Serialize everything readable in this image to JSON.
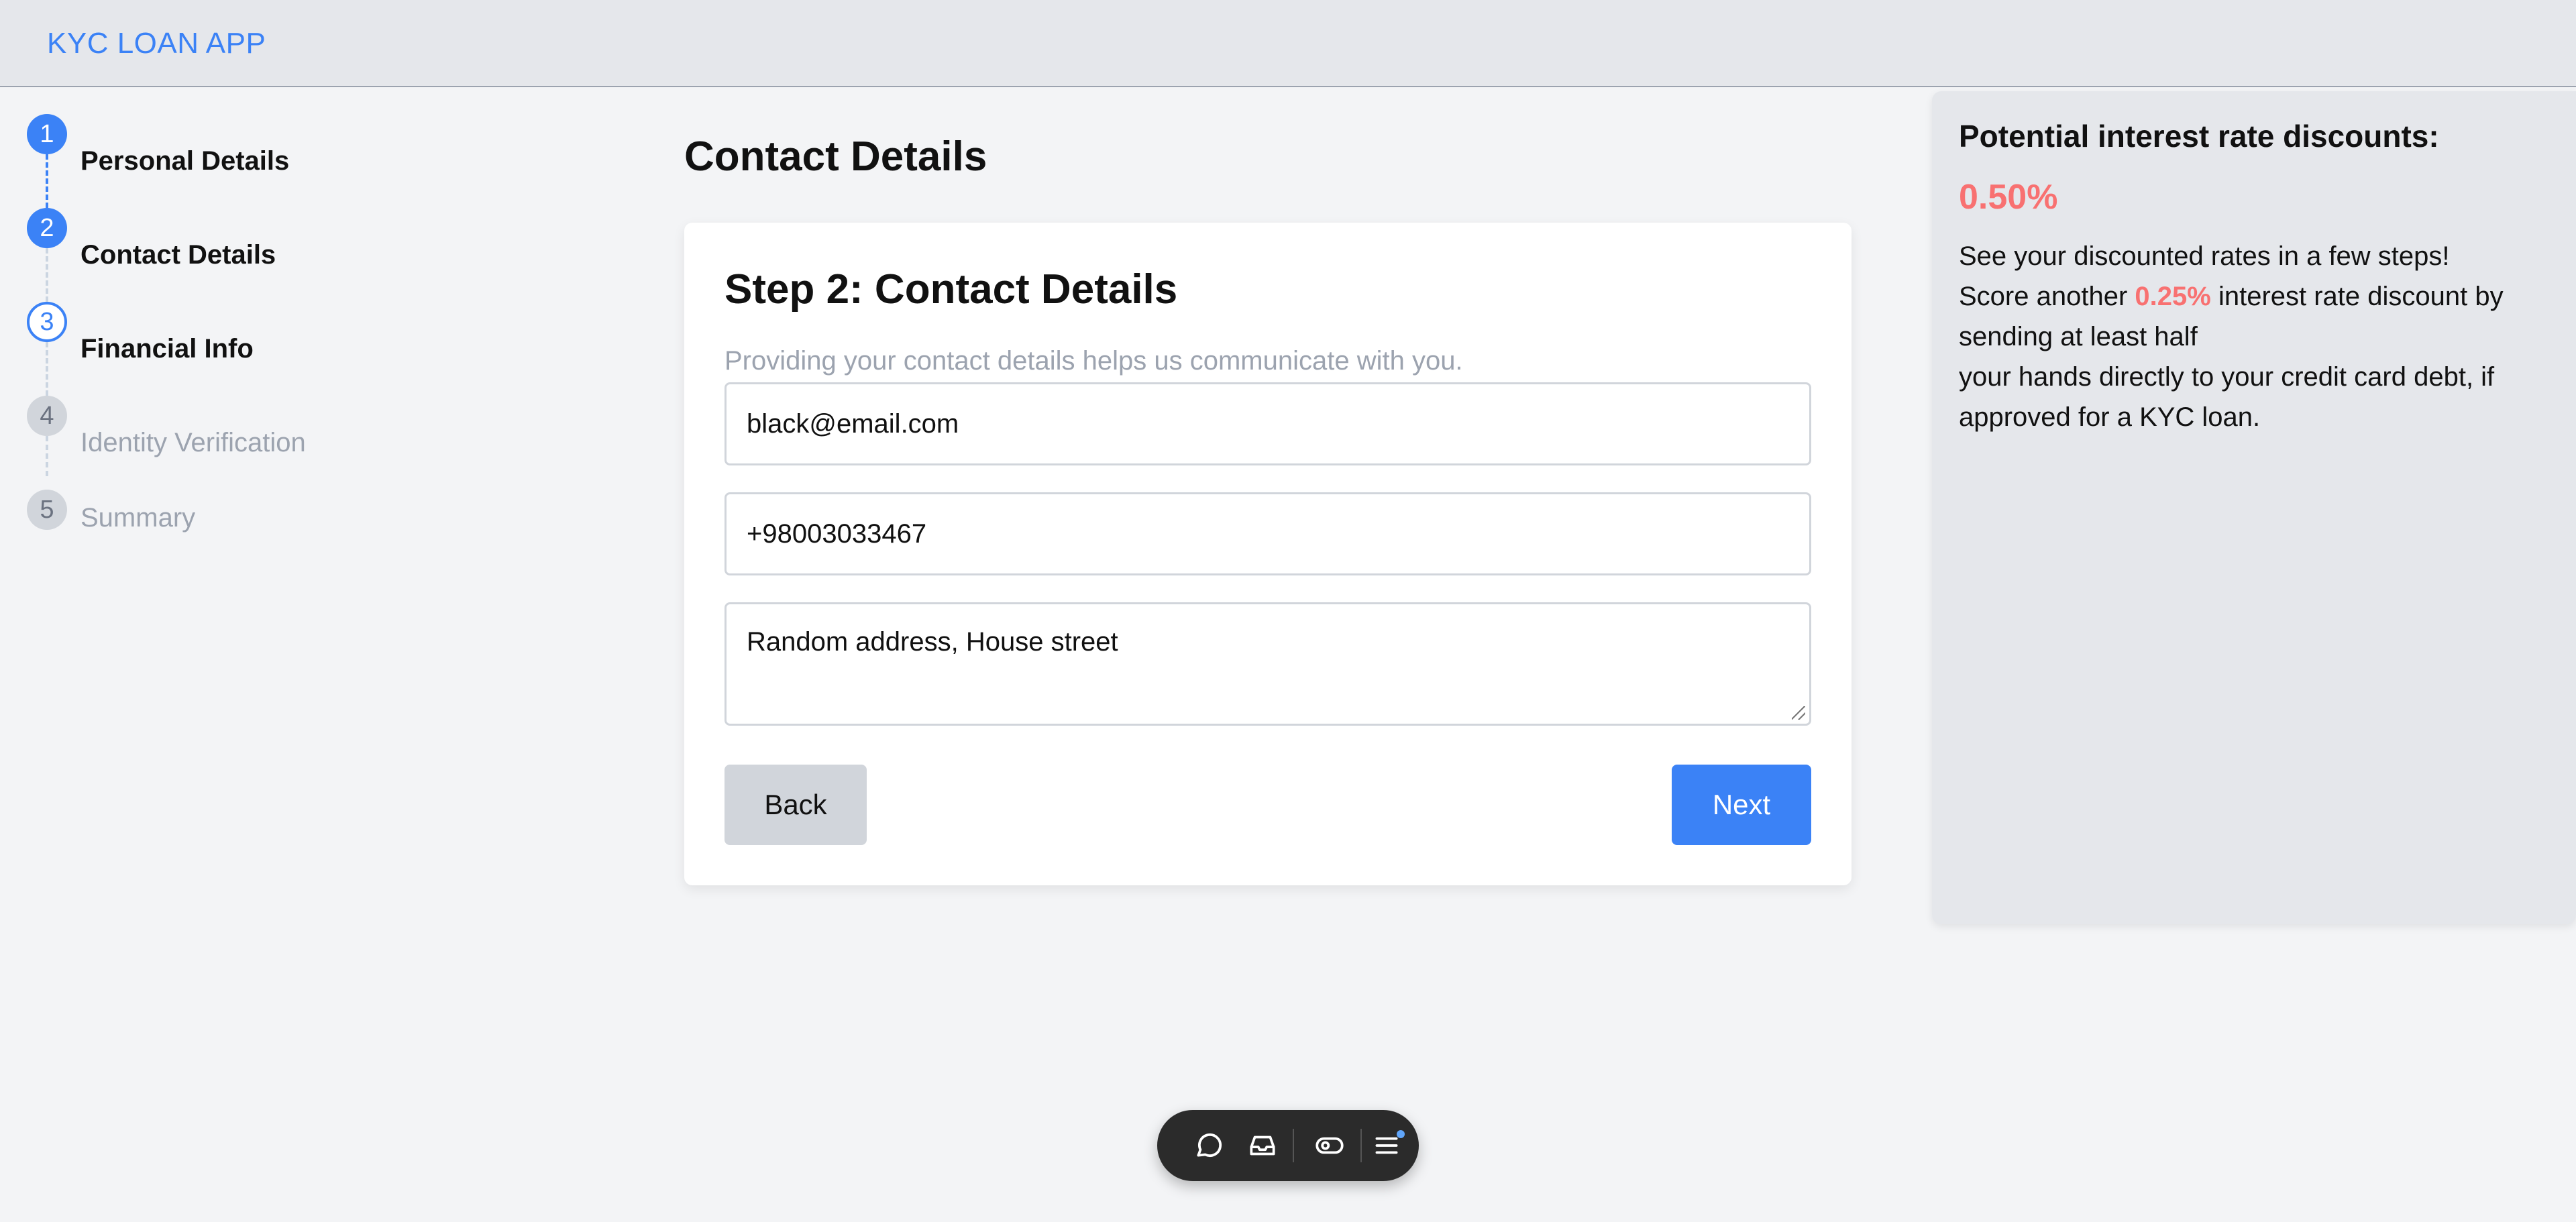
{
  "app": {
    "brand": "KYC LOAN APP"
  },
  "stepper": {
    "steps": [
      {
        "num": "1",
        "label": "Personal Details",
        "state": "complete"
      },
      {
        "num": "2",
        "label": "Contact Details",
        "state": "current"
      },
      {
        "num": "3",
        "label": "Financial Info",
        "state": "next"
      },
      {
        "num": "4",
        "label": "Identity Verification",
        "state": "pending"
      },
      {
        "num": "5",
        "label": "Summary",
        "state": "pending"
      }
    ]
  },
  "main": {
    "page_title": "Contact Details",
    "card": {
      "title": "Step 2: Contact Details",
      "description": "Providing your contact details helps us communicate with you.",
      "email_value": "black@email.com",
      "phone_value": "+98003033467",
      "address_value": "Random address, House street",
      "back_label": "Back",
      "next_label": "Next"
    }
  },
  "panel": {
    "title": "Potential interest rate discounts:",
    "rate": "0.50%",
    "line1": "See your discounted rates in a few steps!",
    "score_prefix": "Score another",
    "score_rate": "0.25%",
    "score_suffix": "interest rate discount by sending at least half",
    "line3": "your hands directly to your credit card debt, if approved for a KYC loan."
  },
  "toolbar": {
    "icons": [
      "chat-icon",
      "inbox-icon",
      "eye-toggle-icon",
      "menu-icon"
    ]
  },
  "colors": {
    "accent": "#3b82f6",
    "discount": "#f87171",
    "topbar": "#e5e7eb",
    "background": "#f3f4f6"
  }
}
